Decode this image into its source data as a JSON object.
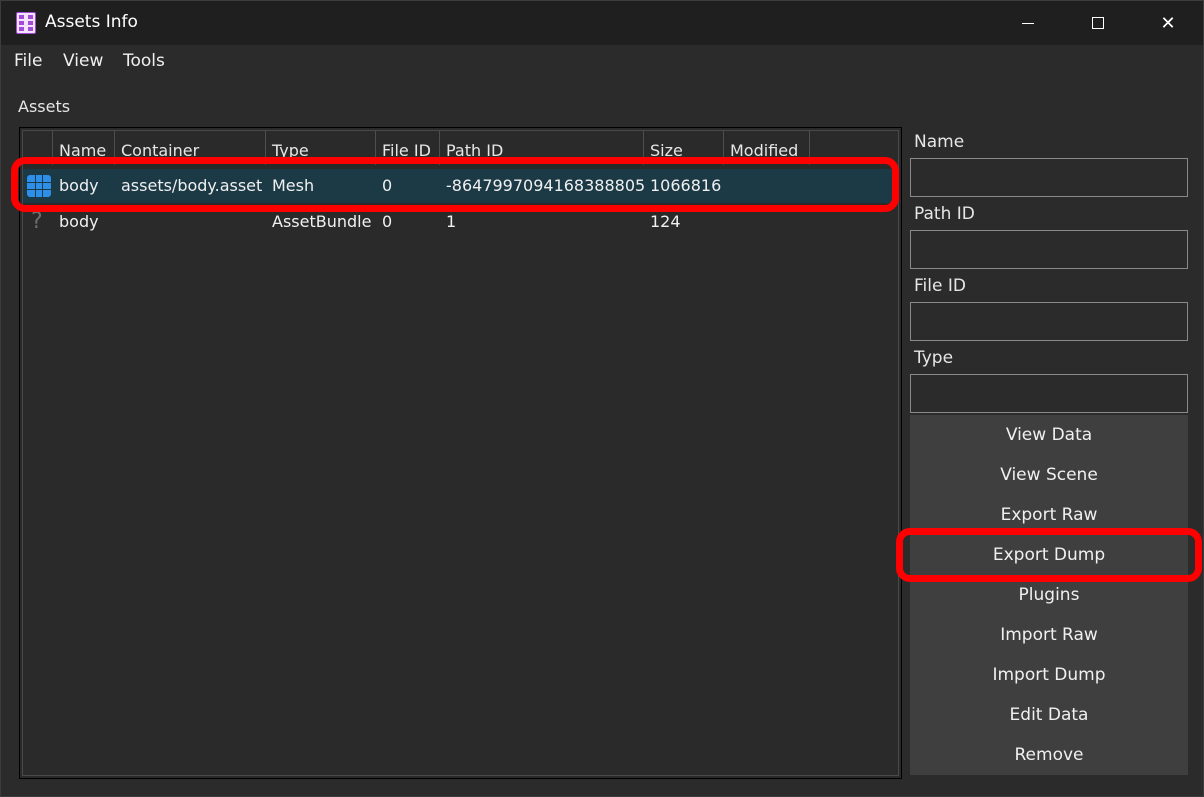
{
  "window": {
    "title": "Assets Info",
    "controls": {
      "minimize": "",
      "maximize": "",
      "close": "✕"
    }
  },
  "menu": [
    "File",
    "View",
    "Tools"
  ],
  "assets_label": "Assets",
  "table": {
    "columns": [
      "Name",
      "Container",
      "Type",
      "File ID",
      "Path ID",
      "Size",
      "Modified"
    ],
    "rows": [
      {
        "icon": "mesh-icon",
        "name": "body",
        "container": "assets/body.asset",
        "type": "Mesh",
        "file_id": "0",
        "path_id": "-8647997094168388805",
        "size": "1066816",
        "modified": "",
        "selected": true
      },
      {
        "icon": "question-icon",
        "icon_glyph": "?",
        "name": "body",
        "container": "",
        "type": "AssetBundle",
        "file_id": "0",
        "path_id": "1",
        "size": "124",
        "modified": "",
        "selected": false
      }
    ]
  },
  "details": {
    "name_label": "Name",
    "name_value": "",
    "path_id_label": "Path ID",
    "path_id_value": "",
    "file_id_label": "File ID",
    "file_id_value": "",
    "type_label": "Type",
    "type_value": ""
  },
  "buttons": [
    "View Data",
    "View Scene",
    "Export Raw",
    "Export Dump",
    "Plugins",
    "Import Raw",
    "Import Dump",
    "Edit Data",
    "Remove"
  ],
  "colors": {
    "highlight": "#ff0000",
    "selected_row": "#1c3a46",
    "mesh_icon": "#2e8fe8",
    "app_icon_accent": "#a24bd6"
  }
}
